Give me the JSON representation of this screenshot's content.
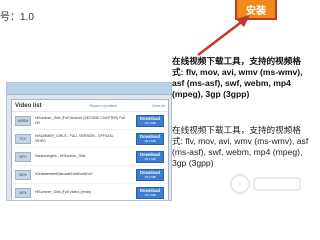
{
  "version_text": "号：1.0",
  "install_button_label": "安装",
  "info_primary": "在线视频下载工具，支持的视频格式: flv, mov, avi, wmv (ms-wmv), asf (ms-asf), swf, webm, mp4 (mpeg), 3gp (3gpp)",
  "info_secondary": "在线视频下载工具，支持的视频格式: flv, mov, avi, wmv (ms-wmv), asf (ms-asf), swf, webm, mp4 (mpeg), 3gp (3gpp)",
  "panel": {
    "title": "Video list",
    "report_link": "Report a problem",
    "clear_link": "Clear All",
    "download_label": "Download",
    "download_sub": "18.1 MB",
    "rows": [
      {
        "format": "WEBM",
        "title": "HiSummer_Girls (Full Version) (SECOND CHAPTER) Full HD"
      },
      {
        "format": "FLV",
        "title": "HISUMMER_GIRLS - FULL VERSION - OFFICIAL VIDEO"
      },
      {
        "format": "MP4",
        "title": "hisummergirls - HiSummer_Girls"
      },
      {
        "format": "MOV",
        "title": "b2edeeeeeeef0abcade1fcd0ca4b1a7"
      },
      {
        "format": "MP4",
        "title": "HiSummer_Girls (Full Video) (remix)"
      }
    ]
  },
  "colors": {
    "install_bg": "#f08a1c",
    "arrow": "#c0392b",
    "download_bg": "#3c7dd3"
  }
}
